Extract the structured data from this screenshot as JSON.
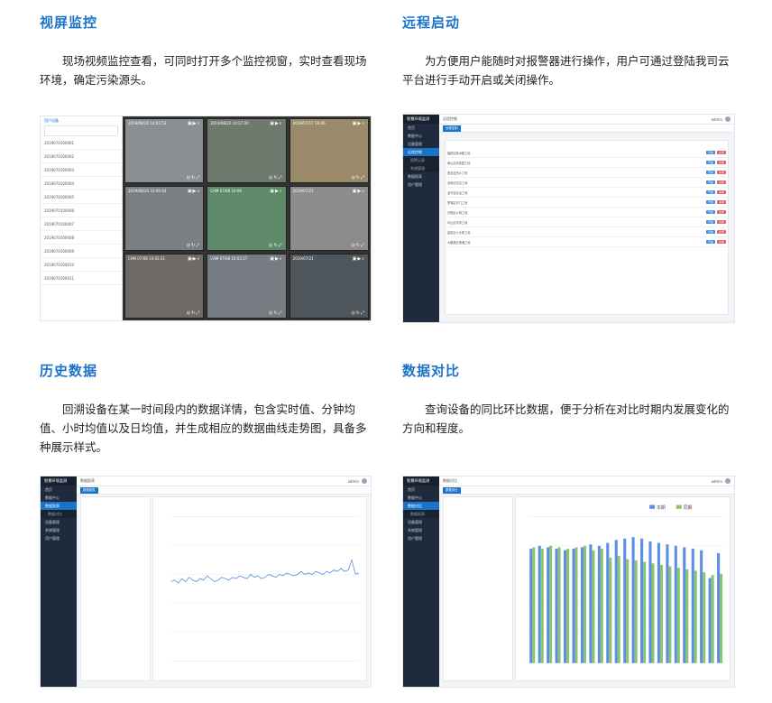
{
  "sections": [
    {
      "title": "视屏监控",
      "desc": "现场视频监控查看，可同时打开多个监控视窗，实时查看现场环境，确定污染源头。"
    },
    {
      "title": "远程启动",
      "desc": "为方便用户能随时对报警器进行操作，用户可通过登陆我司云平台进行手动开启或关闭操作。"
    },
    {
      "title": "历史数据",
      "desc": "回溯设备在某一时间段内的数据详情，包含实时值、分钟均值、小时均值以及日均值，并生成相应的数据曲线走势图，具备多种展示样式。"
    },
    {
      "title": "数据对比",
      "desc": "查询设备的同比环比数据，便于分析在对比时期内发展变化的方向和程度。"
    }
  ],
  "video": {
    "list_title": "用户设备",
    "list_rows": [
      "2019070100001",
      "2019070100002",
      "2019070100003",
      "2019070100004",
      "2019070100005",
      "2019070100006",
      "2019070100007",
      "2019070100008",
      "2019070100009",
      "2019070100010",
      "2019070100011"
    ],
    "cameras": [
      {
        "caption": "2019/08/20 14:03:53",
        "color": "#8a8f94"
      },
      {
        "caption": "2019/08/20 10:27:00",
        "color": "#6f7a6e"
      },
      {
        "caption": "2019/07/17 16:46",
        "color": "#9a8a6a"
      },
      {
        "caption": "2019/08/20 10:09:44",
        "color": "#7b7f84"
      },
      {
        "caption": "CAM 07/08 10:09",
        "color": "#5e8a6a"
      },
      {
        "caption": "2019/07/21",
        "color": "#8c8c8c"
      },
      {
        "caption": "CAM 07/08 10:02:21",
        "color": "#6e6a66"
      },
      {
        "caption": "CAM 07/08 10:02:27",
        "color": "#777c82"
      },
      {
        "caption": "2019/07/21",
        "color": "#4f565c"
      }
    ]
  },
  "admin": {
    "brand": "智慧环境监测",
    "menu": [
      "首页",
      "数据中心",
      "设备管理",
      "远程控制",
      "报警记录",
      "系统管理",
      "数据报表",
      "数据对比",
      "用户管理"
    ],
    "user": "admin",
    "switch_rows": [
      "福田区新洲路工地",
      "南山区科技园工地",
      "宝安区西乡工地",
      "龙岗区布吉工地",
      "龙华区民治工地",
      "罗湖区东门工地",
      "光明区公明工地",
      "坪山区坑梓工地",
      "盐田区沙头角工地",
      "大鹏新区葵涌工地"
    ],
    "on_label": "开启",
    "off_label": "关闭"
  },
  "history_chart": {
    "values": [
      0.55,
      0.56,
      0.54,
      0.57,
      0.55,
      0.58,
      0.56,
      0.55,
      0.57,
      0.56,
      0.59,
      0.57,
      0.55,
      0.56,
      0.58,
      0.57,
      0.56,
      0.58,
      0.57,
      0.59,
      0.58,
      0.57,
      0.6,
      0.58,
      0.59,
      0.57,
      0.58,
      0.6,
      0.59,
      0.58,
      0.6,
      0.59,
      0.61,
      0.6,
      0.59,
      0.6,
      0.62,
      0.6,
      0.61,
      0.6,
      0.62,
      0.61,
      0.6,
      0.62,
      0.61,
      0.63,
      0.62,
      0.64,
      0.62,
      0.63,
      0.7,
      0.6,
      0.61
    ]
  },
  "compare_chart": {
    "series": [
      {
        "name": "本期",
        "color": "#5b8ee6",
        "values": [
          78,
          80,
          79,
          78,
          77,
          78,
          79,
          81,
          80,
          82,
          84,
          85,
          86,
          85,
          83,
          82,
          81,
          80,
          79,
          78,
          77,
          58,
          75
        ]
      },
      {
        "name": "同期",
        "color": "#8cc56a",
        "values": [
          79,
          78,
          80,
          79,
          78,
          79,
          80,
          77,
          78,
          72,
          73,
          71,
          70,
          69,
          68,
          67,
          66,
          65,
          64,
          63,
          62,
          60,
          61
        ]
      }
    ]
  }
}
